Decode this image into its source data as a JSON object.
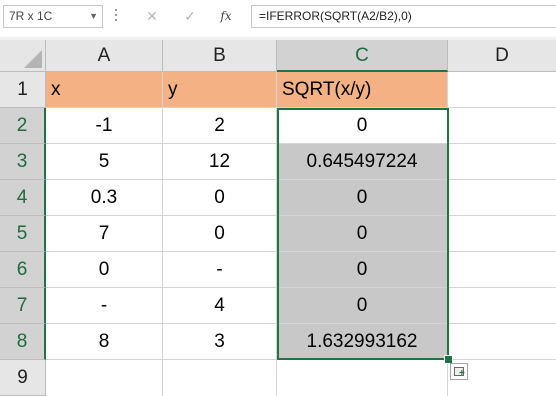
{
  "formula_bar": {
    "name_box": "7R x 1C",
    "cancel_symbol": "✕",
    "enter_symbol": "✓",
    "fx_label": "fx",
    "formula": "=IFERROR(SQRT(A2/B2),0)"
  },
  "columns": [
    "A",
    "B",
    "C",
    "D"
  ],
  "selected_column": "C",
  "rows": [
    "1",
    "2",
    "3",
    "4",
    "5",
    "6",
    "7",
    "8",
    "9"
  ],
  "headers": {
    "a": "x",
    "b": "y",
    "c": "SQRT(x/y)"
  },
  "data_rows": [
    {
      "a": "-1",
      "b": "2",
      "c": "0"
    },
    {
      "a": "5",
      "b": "12",
      "c": "0.645497224"
    },
    {
      "a": "0.3",
      "b": "0",
      "c": "0"
    },
    {
      "a": "7",
      "b": "0",
      "c": "0"
    },
    {
      "a": "0",
      "b": "-",
      "c": "0"
    },
    {
      "a": "-",
      "b": "4",
      "c": "0"
    },
    {
      "a": "8",
      "b": "3",
      "c": "1.632993162"
    }
  ],
  "selection": {
    "range_rows": "2-8",
    "column": "C"
  },
  "colors": {
    "header_fill": "#f4b183",
    "selection_fill": "#c8c8c8",
    "selection_border": "#217346"
  },
  "icons": [
    "chevron-down-icon",
    "cancel-icon",
    "enter-icon",
    "function-icon",
    "quick-analysis-icon",
    "select-all-icon"
  ]
}
